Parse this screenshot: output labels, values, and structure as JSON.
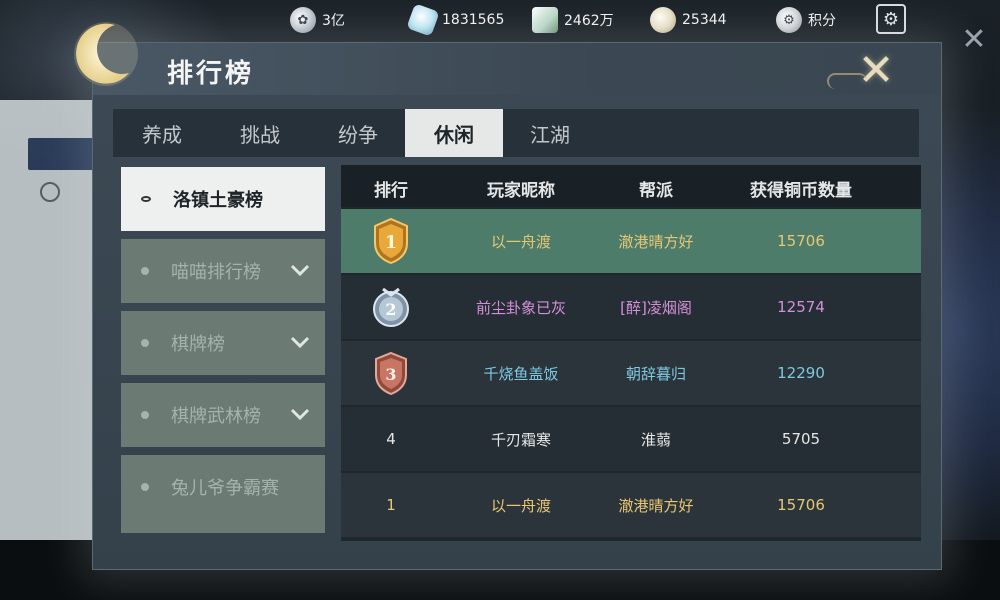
{
  "resources": [
    {
      "icon": "coin-icon",
      "value": "3亿"
    },
    {
      "icon": "silver-gem-icon",
      "value": "1831565"
    },
    {
      "icon": "jade-scroll-icon",
      "value": "2462万"
    },
    {
      "icon": "money-sack-icon",
      "value": "25344"
    },
    {
      "icon": "points-icon",
      "value": "积分"
    }
  ],
  "panel": {
    "title": "排行榜"
  },
  "tabs": [
    {
      "label": "养成",
      "active": false
    },
    {
      "label": "挑战",
      "active": false
    },
    {
      "label": "纷争",
      "active": false
    },
    {
      "label": "休闲",
      "active": true
    },
    {
      "label": "江湖",
      "active": false
    }
  ],
  "categories": [
    {
      "label": "洛镇土豪榜",
      "active": true,
      "expandable": false
    },
    {
      "label": "喵喵排行榜",
      "active": false,
      "expandable": true
    },
    {
      "label": "棋牌榜",
      "active": false,
      "expandable": true
    },
    {
      "label": "棋牌武林榜",
      "active": false,
      "expandable": true
    },
    {
      "label": "兔儿爷争霸赛",
      "active": false,
      "expandable": false
    }
  ],
  "table": {
    "headers": [
      "排行",
      "玩家昵称",
      "帮派",
      "获得铜币数量"
    ],
    "rows": [
      {
        "rank": "1",
        "medal": "gold",
        "name": "以一舟渡",
        "guild": "澈港晴方好",
        "coins": "15706",
        "color": "#e8c773"
      },
      {
        "rank": "2",
        "medal": "silver",
        "name": "前尘卦象已灰",
        "guild": "[醉]凌烟阁",
        "coins": "12574",
        "color": "#d58fd9"
      },
      {
        "rank": "3",
        "medal": "bronze",
        "name": "千烧鱼盖饭",
        "guild": "朝辞暮归",
        "coins": "12290",
        "color": "#7ec8e0"
      },
      {
        "rank": "4",
        "medal": "",
        "name": "千刃霜寒",
        "guild": "淮蒻",
        "coins": "5705",
        "color": "#e6e6e6"
      },
      {
        "rank": "1",
        "medal": "",
        "name": "以一舟渡",
        "guild": "澈港晴方好",
        "coins": "15706",
        "color": "#e8c773"
      }
    ]
  },
  "colors": {
    "highlight_row": "#4d7c6a",
    "active_tab": "#e6e8e8",
    "category_bg": "#6b7a73"
  }
}
